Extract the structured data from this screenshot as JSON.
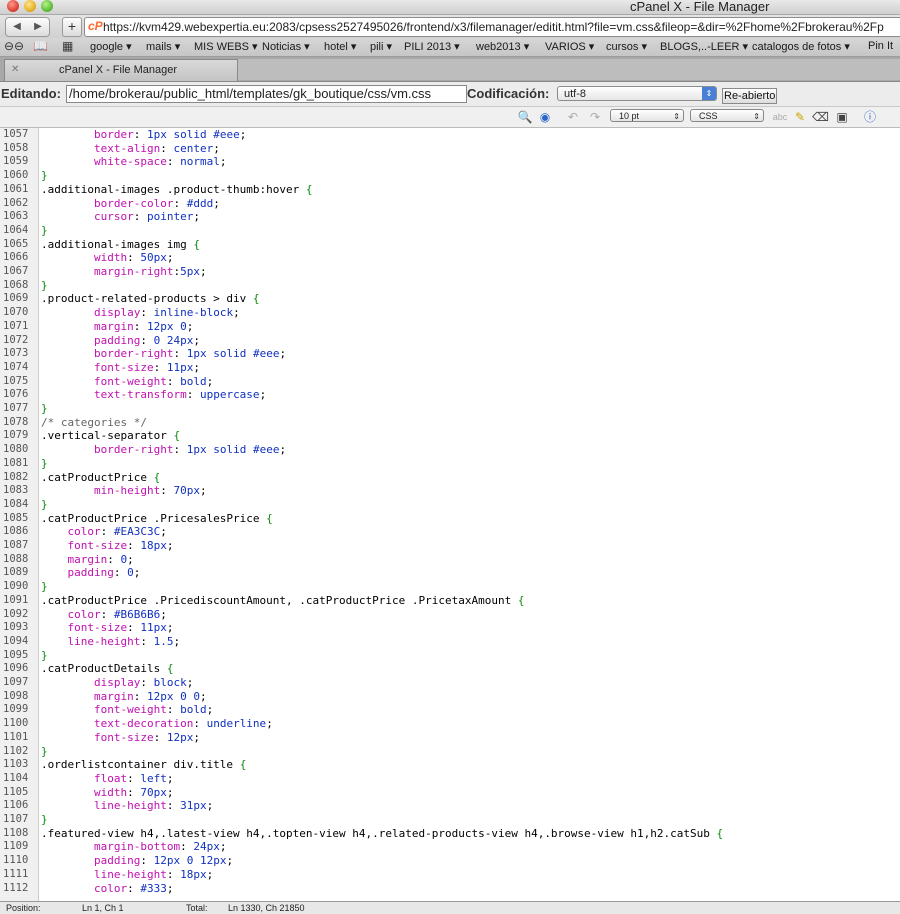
{
  "window": {
    "title": "cPanel X - File Manager"
  },
  "browser": {
    "url": "https://kvm429.webexpertia.eu:2083/cpsess2527495026/frontend/x3/filemanager/editit.html?file=vm.css&fileop=&dir=%2Fhome%2Fbrokerau%2Fp",
    "site_icon": "cP",
    "bookmarks": [
      "google ▾",
      "mails ▾",
      "MIS WEBS ▾",
      "Noticias ▾",
      "hotel ▾",
      "pili ▾",
      "PILI 2013 ▾",
      "web2013 ▾",
      "VARIOS ▾",
      "cursos ▾",
      "BLOGS,..-LEER ▾",
      "catalogos de fotos ▾",
      "Pin It"
    ],
    "tab_title": "cPanel X - File Manager"
  },
  "editor": {
    "editing_label": "Editando:",
    "path": "/home/brokerau/public_html/templates/gk_boutique/css/vm.css",
    "encoding_label": "Codificación:",
    "encoding_value": "utf-8",
    "reopen_label": "Re-abierto",
    "font_size": "10 pt",
    "language": "CSS"
  },
  "code_lines": [
    {
      "n": "1057",
      "t": "        border: 1px solid #eee;"
    },
    {
      "n": "1058",
      "t": "        text-align: center;"
    },
    {
      "n": "1059",
      "t": "        white-space: normal;"
    },
    {
      "n": "1060",
      "t": "}"
    },
    {
      "n": "1061",
      "t": ".additional-images .product-thumb:hover {"
    },
    {
      "n": "1062",
      "t": "        border-color: #ddd;"
    },
    {
      "n": "1063",
      "t": "        cursor: pointer;"
    },
    {
      "n": "1064",
      "t": "}"
    },
    {
      "n": "1065",
      "t": ".additional-images img {"
    },
    {
      "n": "1066",
      "t": "        width: 50px;"
    },
    {
      "n": "1067",
      "t": "        margin-right:5px;"
    },
    {
      "n": "1068",
      "t": "}"
    },
    {
      "n": "1069",
      "t": ".product-related-products > div {"
    },
    {
      "n": "1070",
      "t": "        display: inline-block;"
    },
    {
      "n": "1071",
      "t": "        margin: 12px 0;"
    },
    {
      "n": "1072",
      "t": "        padding: 0 24px;"
    },
    {
      "n": "1073",
      "t": "        border-right: 1px solid #eee;"
    },
    {
      "n": "1074",
      "t": "        font-size: 11px;"
    },
    {
      "n": "1075",
      "t": "        font-weight: bold;"
    },
    {
      "n": "1076",
      "t": "        text-transform: uppercase;"
    },
    {
      "n": "1077",
      "t": "}"
    },
    {
      "n": "1078",
      "t": "/* categories */"
    },
    {
      "n": "1079",
      "t": ".vertical-separator {"
    },
    {
      "n": "1080",
      "t": "        border-right: 1px solid #eee;"
    },
    {
      "n": "1081",
      "t": "}"
    },
    {
      "n": "1082",
      "t": ".catProductPrice {"
    },
    {
      "n": "1083",
      "t": "        min-height: 70px;"
    },
    {
      "n": "1084",
      "t": "}"
    },
    {
      "n": "1085",
      "t": ".catProductPrice .PricesalesPrice {"
    },
    {
      "n": "1086",
      "t": "    color: #EA3C3C;"
    },
    {
      "n": "1087",
      "t": "    font-size: 18px;"
    },
    {
      "n": "1088",
      "t": "    margin: 0;"
    },
    {
      "n": "1089",
      "t": "    padding: 0;"
    },
    {
      "n": "1090",
      "t": "}"
    },
    {
      "n": "1091",
      "t": ".catProductPrice .PricediscountAmount, .catProductPrice .PricetaxAmount {"
    },
    {
      "n": "1092",
      "t": "    color: #B6B6B6;"
    },
    {
      "n": "1093",
      "t": "    font-size: 11px;"
    },
    {
      "n": "1094",
      "t": "    line-height: 1.5;"
    },
    {
      "n": "1095",
      "t": "}"
    },
    {
      "n": "1096",
      "t": ".catProductDetails {"
    },
    {
      "n": "1097",
      "t": "        display: block;"
    },
    {
      "n": "1098",
      "t": "        margin: 12px 0 0;"
    },
    {
      "n": "1099",
      "t": "        font-weight: bold;"
    },
    {
      "n": "1100",
      "t": "        text-decoration: underline;"
    },
    {
      "n": "1101",
      "t": "        font-size: 12px;"
    },
    {
      "n": "1102",
      "t": "}"
    },
    {
      "n": "1103",
      "t": ".orderlistcontainer div.title {"
    },
    {
      "n": "1104",
      "t": "        float: left;"
    },
    {
      "n": "1105",
      "t": "        width: 70px;"
    },
    {
      "n": "1106",
      "t": "        line-height: 31px;"
    },
    {
      "n": "1107",
      "t": "}"
    },
    {
      "n": "1108",
      "t": ".featured-view h4,.latest-view h4,.topten-view h4,.related-products-view h4,.browse-view h1,h2.catSub {"
    },
    {
      "n": "1109",
      "t": "        margin-bottom: 24px;"
    },
    {
      "n": "1110",
      "t": "        padding: 12px 0 12px;"
    },
    {
      "n": "1111",
      "t": "        line-height: 18px;"
    },
    {
      "n": "1112",
      "t": "        color: #333;"
    }
  ],
  "status": {
    "position_label": "Position:",
    "position_value": "Ln 1, Ch 1",
    "total_label": "Total:",
    "total_value": "Ln 1330, Ch 21850"
  }
}
